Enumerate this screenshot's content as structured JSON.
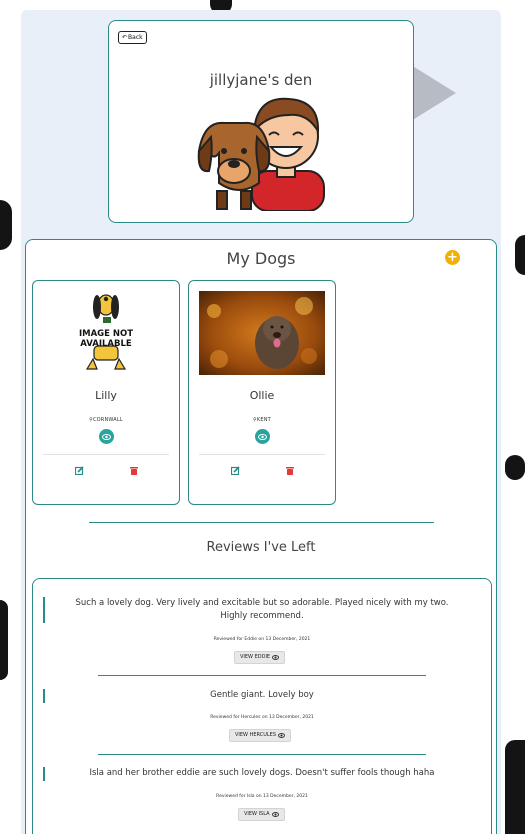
{
  "profile": {
    "back_label": "Back",
    "title": "jillyjane's den"
  },
  "dogs_section": {
    "title": "My Dogs",
    "add_icon": "plus-circle-icon",
    "dogs": [
      {
        "name": "Lilly",
        "location": "CORNWALL",
        "image": "image-not-available-placeholder"
      },
      {
        "name": "Ollie",
        "location": "KENT",
        "image": "dog-photo"
      }
    ]
  },
  "reviews_section": {
    "title": "Reviews I've Left",
    "reviews": [
      {
        "text": "Such a lovely dog. Very lively and excitable but so adorable. Played nicely with my two. Highly recommend.",
        "meta": "Reviewed for Eddie on 13 December, 2021",
        "button_label": "VIEW EDDIE"
      },
      {
        "text": "Gentle giant. Lovely boy",
        "meta": "Reviewed for Hercules on 13 December, 2021",
        "button_label": "VIEW HERCULES"
      },
      {
        "text": "Isla and her brother eddie are such lovely dogs. Doesn't suffer fools though haha",
        "meta": "Reviewed for Isla on 13 December, 2021",
        "button_label": "VIEW ISLA"
      }
    ]
  },
  "colors": {
    "teal": "#2a8a86",
    "accent": "#f2b100",
    "danger": "#e53935",
    "panel_bg": "#e9eff8"
  }
}
